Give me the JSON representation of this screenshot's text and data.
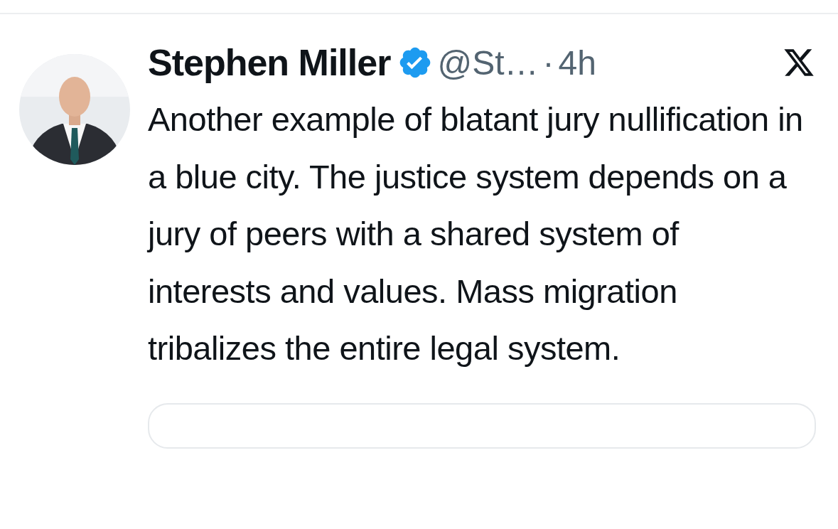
{
  "post": {
    "author": {
      "name": "Stephen Miller",
      "verified": true,
      "handle": "@St…",
      "separator": "·",
      "time": "4h"
    },
    "text": "Another example of blatant jury nullification in a blue city. The justice system depends on a jury of peers with a shared system of interests and values. Mass migration tribalizes the entire legal system."
  }
}
